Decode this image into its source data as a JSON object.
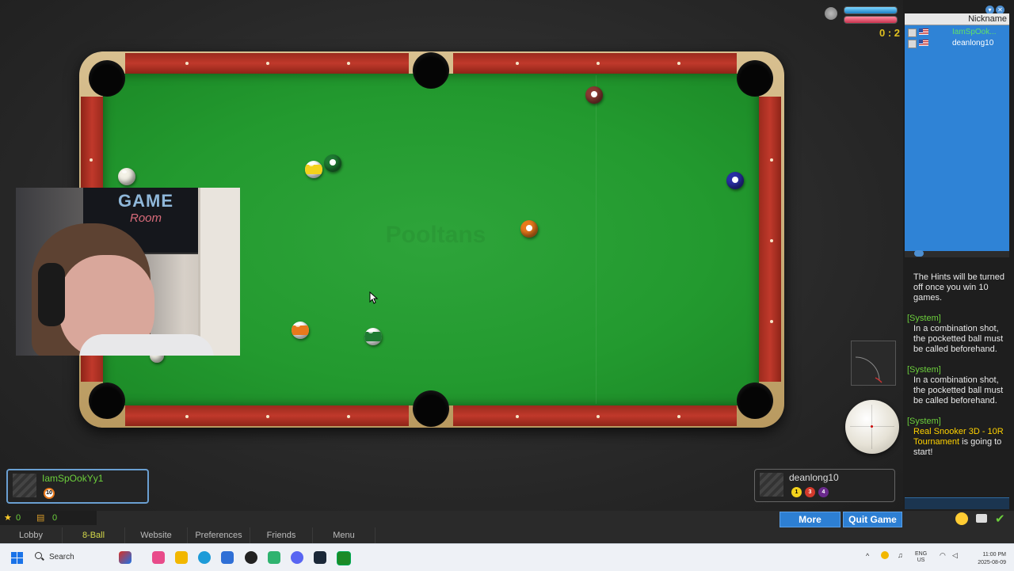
{
  "hud": {
    "score": "0 : 2",
    "watermark": "Pooltans"
  },
  "players": {
    "p1": {
      "name": "IamSpOokYy1",
      "balls": [
        "10"
      ]
    },
    "p2": {
      "name": "deanlong10",
      "balls": [
        "1",
        "3",
        "4"
      ]
    }
  },
  "player_list": {
    "header": "Nickname",
    "rows": [
      {
        "nick": "IamSpOok..."
      },
      {
        "nick": "deanlong10"
      }
    ]
  },
  "chat": [
    {
      "tag": "",
      "text": "The Hints will be turned off once you win 10 games."
    },
    {
      "tag": "[System]",
      "text": "In a combination shot, the pocketted ball must be called beforehand."
    },
    {
      "tag": "[System]",
      "text": "In a combination shot, the pocketted ball must be called beforehand."
    },
    {
      "tag": "[System]",
      "highlight": "Real Snooker 3D - 10R Tournament",
      "text": " is going to start!"
    }
  ],
  "resources": {
    "stars": "0",
    "chests": "0"
  },
  "buttons": {
    "more": "More",
    "quit": "Quit Game"
  },
  "nav_tabs": [
    "Lobby",
    "8-Ball",
    "Website",
    "Preferences",
    "Friends",
    "Menu"
  ],
  "webcam": {
    "poster_title": "GAME",
    "poster_sub": "Room"
  },
  "taskbar": {
    "search_placeholder": "Search",
    "lang_1": "ENG",
    "lang_2": "US",
    "time": "11:00 PM",
    "date": "2025-08-09"
  },
  "balls": [
    {
      "id": "cue",
      "color": "#f3f1e6",
      "striped": false
    },
    {
      "id": "ball-9",
      "color": "#f4d21c",
      "striped": true
    },
    {
      "id": "ball-6",
      "color": "#1e7a32",
      "striped": false
    },
    {
      "id": "ball-13",
      "color": "#e8791c",
      "striped": true
    },
    {
      "id": "ball-14",
      "color": "#1e7a32",
      "striped": true
    },
    {
      "id": "ball-5",
      "color": "#e8791c",
      "striped": false
    },
    {
      "id": "ball-2",
      "color": "#2a2fa6",
      "striped": false
    },
    {
      "id": "ball-7",
      "color": "#8a3a33",
      "striped": false
    }
  ],
  "colors": {
    "cloth": "#239a2f",
    "rail": "#c0392b",
    "accent_button": "#2d7fd3",
    "player_list_bg": "#2f83d6",
    "system_tag": "#6ccf3c",
    "highlight": "#ffd200"
  }
}
